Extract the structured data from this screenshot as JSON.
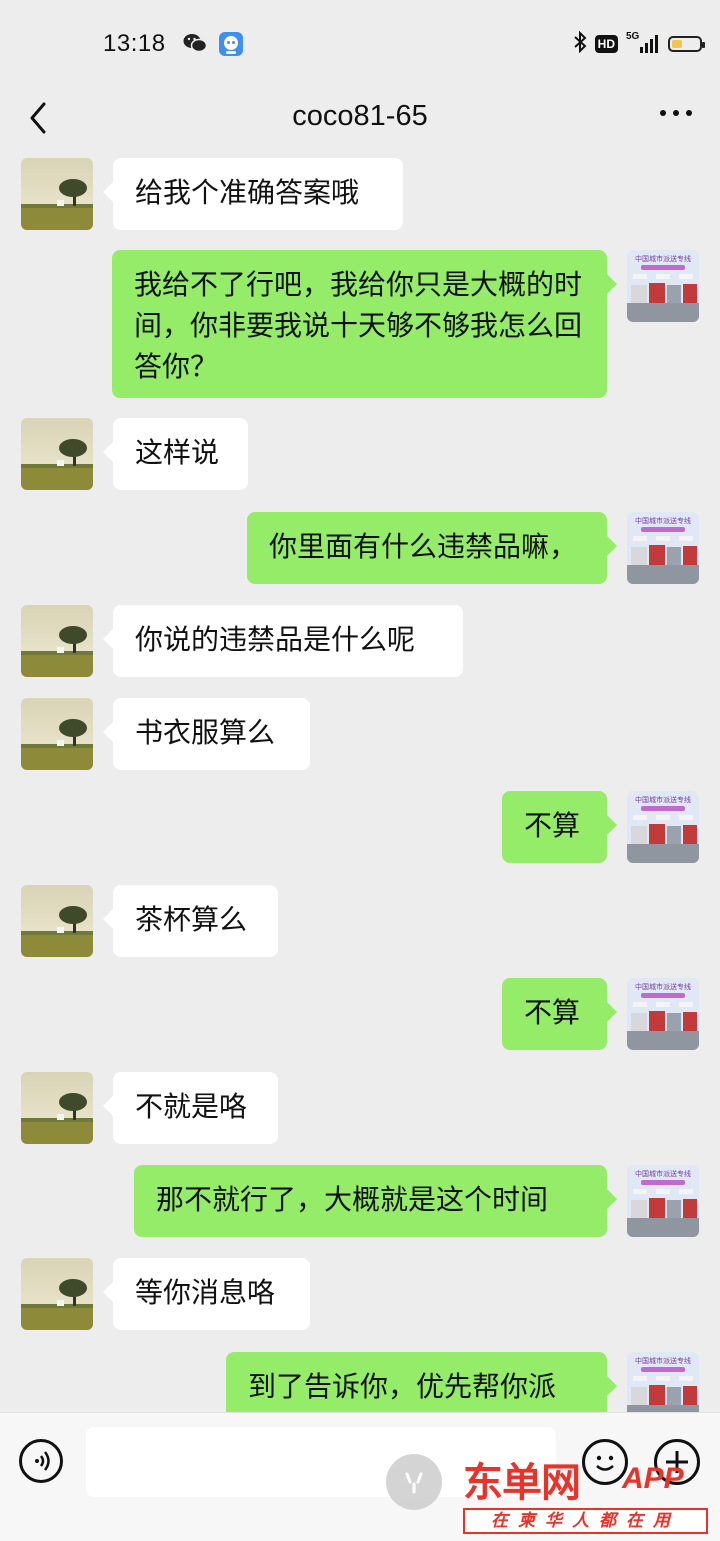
{
  "status_bar": {
    "time": "13:18",
    "network_label": "5G",
    "hd_label": "HD",
    "icons": [
      "wechat-icon",
      "app-notification-icon",
      "bluetooth-icon",
      "signal-icon",
      "battery-icon"
    ],
    "battery_color": "#f2c64a"
  },
  "header": {
    "title": "coco81-65",
    "back_icon": "chevron-left-icon",
    "more_icon": "more-dots-icon"
  },
  "colors": {
    "background": "#ededed",
    "incoming_bubble": "#ffffff",
    "outgoing_bubble": "#95ec69",
    "watermark_red": "#e8332a"
  },
  "messages": [
    {
      "side": "in",
      "text": "给我个准确答案哦"
    },
    {
      "side": "out",
      "text": "我给不了行吧，我给你只是大概的时间，你非要我说十天够不够我怎么回答你？"
    },
    {
      "side": "in",
      "text": "这样说"
    },
    {
      "side": "out",
      "text": "你里面有什么违禁品嘛，"
    },
    {
      "side": "in",
      "text": "你说的违禁品是什么呢"
    },
    {
      "side": "in",
      "text": "书衣服算么"
    },
    {
      "side": "out",
      "text": "不算"
    },
    {
      "side": "in",
      "text": "茶杯算么"
    },
    {
      "side": "out",
      "text": "不算"
    },
    {
      "side": "in",
      "text": "不就是咯"
    },
    {
      "side": "out",
      "text": "那不就行了，大概就是这个时间"
    },
    {
      "side": "in",
      "text": "等你消息咯"
    },
    {
      "side": "out",
      "text": "到了告诉你，优先帮你派"
    }
  ],
  "my_avatar_text": "中国城市派送专线",
  "input_bar": {
    "voice_icon": "voice-icon",
    "emoji_icon": "emoji-icon",
    "plus_icon": "plus-icon",
    "input_value": ""
  },
  "watermark": {
    "logo": "东单网",
    "app": "APP",
    "slogan": "在柬华人都在用"
  }
}
